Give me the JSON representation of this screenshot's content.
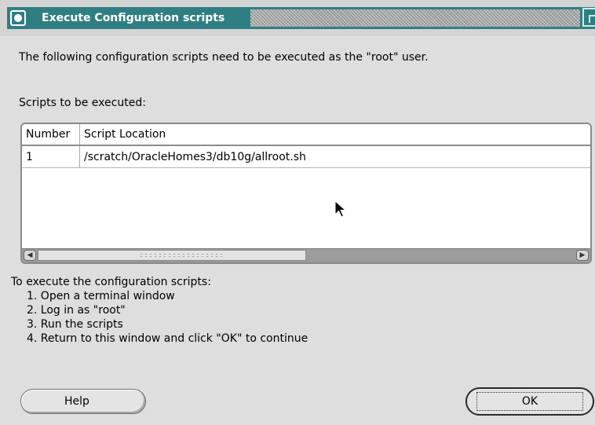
{
  "window": {
    "title": "Execute Configuration scripts"
  },
  "intro_text": "The following configuration scripts need to be executed as the \"root\" user.",
  "scripts_label": "Scripts to be executed:",
  "table": {
    "columns": [
      "Number",
      "Script Location"
    ],
    "rows": [
      {
        "number": "1",
        "location": "/scratch/OracleHomes3/db10g/allroot.sh"
      }
    ]
  },
  "instructions": {
    "heading": "To execute the configuration scripts:",
    "steps": [
      "1. Open a terminal window",
      "2. Log in as \"root\"",
      "3. Run the scripts",
      "4. Return to this window and click \"OK\" to continue"
    ]
  },
  "buttons": {
    "help": "Help",
    "ok": "OK"
  },
  "colors": {
    "titlebar": "#2f7f82",
    "background": "#dedede"
  }
}
